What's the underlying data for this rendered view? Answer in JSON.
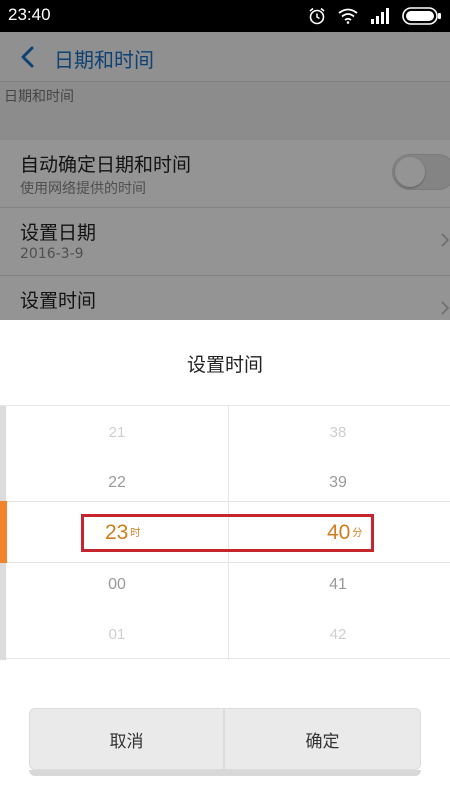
{
  "status_bar": {
    "time": "23:40",
    "icons": [
      "alarm-icon",
      "wifi-icon",
      "signal-icon",
      "battery-icon"
    ]
  },
  "settings": {
    "title": "日期和时间",
    "section_label": "日期和时间",
    "items": [
      {
        "title": "自动确定日期和时间",
        "subtitle": "使用网络提供的时间",
        "control": "toggle",
        "on": false
      },
      {
        "title": "设置日期",
        "subtitle": "2016-3-9",
        "control": "chevron"
      },
      {
        "title": "设置时间",
        "subtitle": "",
        "control": "chevron"
      }
    ]
  },
  "dialog": {
    "title": "设置时间",
    "hour_column": {
      "above": [
        "21",
        "22"
      ],
      "selected": "23",
      "unit": "时",
      "below": [
        "00",
        "01"
      ]
    },
    "minute_column": {
      "above": [
        "38",
        "39"
      ],
      "selected": "40",
      "unit": "分",
      "below": [
        "41",
        "42"
      ]
    },
    "cancel_label": "取消",
    "confirm_label": "确定"
  },
  "colors": {
    "accent_orange": "#f2852b",
    "selected_text": "#d17d1c",
    "highlight_box": "#c7252d",
    "header_blue": "#1b73c9"
  }
}
